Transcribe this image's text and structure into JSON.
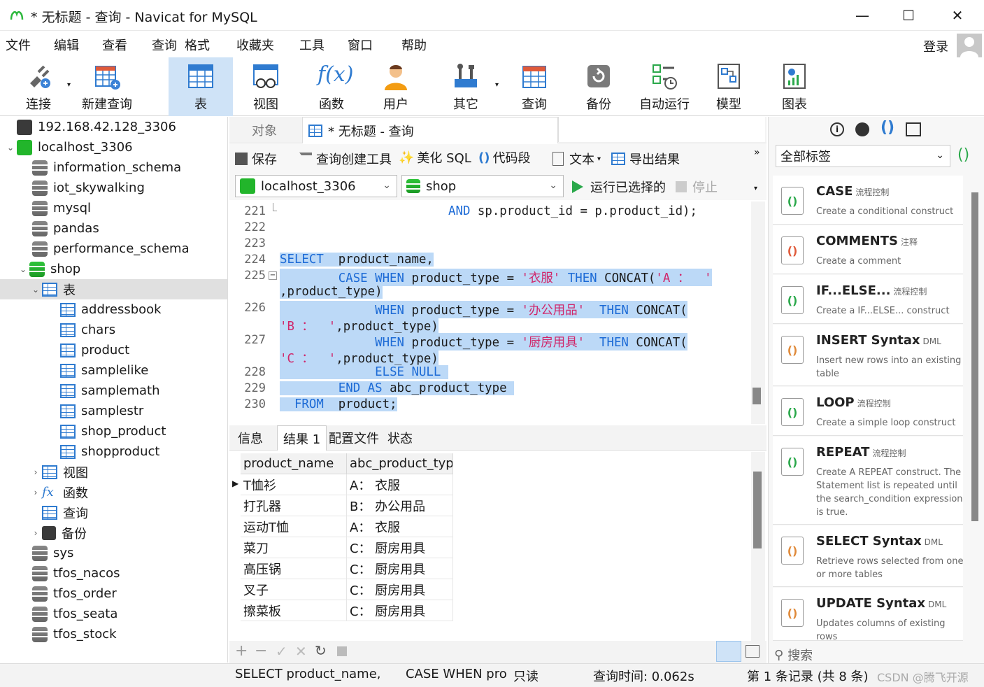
{
  "window": {
    "title": "* 无标题 - 查询 - Navicat for MySQL"
  },
  "menu": [
    "文件",
    "编辑",
    "查看",
    "查询",
    "格式",
    "收藏夹",
    "工具",
    "窗口",
    "帮助"
  ],
  "login": "登录",
  "toolbar": {
    "connect": "连接",
    "new_query": "新建查询",
    "table": "表",
    "view": "视图",
    "function": "函数",
    "user": "用户",
    "other": "其它",
    "query": "查询",
    "backup": "备份",
    "auto_run": "自动运行",
    "model": "模型",
    "chart": "图表"
  },
  "tree": {
    "conn1": "192.168.42.128_3306",
    "conn2": "localhost_3306",
    "dbs": [
      "information_schema",
      "iot_skywalking",
      "mysql",
      "pandas",
      "performance_schema",
      "shop"
    ],
    "tables_group": "表",
    "tables": [
      "addressbook",
      "chars",
      "product",
      "samplelike",
      "samplemath",
      "samplestr",
      "shop_product",
      "shopproduct"
    ],
    "views": "视图",
    "functions": "函数",
    "queries": "查询",
    "backups": "备份",
    "dbs_after": [
      "sys",
      "tfos_nacos",
      "tfos_order",
      "tfos_seata",
      "tfos_stock"
    ]
  },
  "tabs": {
    "objects": "对象",
    "query_tab": "* 无标题 - 查询"
  },
  "sql_tools": {
    "save": "保存",
    "builder": "查询创建工具",
    "beautify": "美化 SQL",
    "snippet": "代码段",
    "text": "文本",
    "export": "导出结果"
  },
  "selectors": {
    "connection": "localhost_3306",
    "database": "shop",
    "run_selected": "运行已选择的",
    "stop": "停止"
  },
  "editor": {
    "lines": [
      {
        "n": "221",
        "text": "AND sp.product_id = p.product_id);"
      },
      {
        "n": "222",
        "text": ""
      },
      {
        "n": "223",
        "text": ""
      },
      {
        "n": "224",
        "text": "SELECT  product_name,"
      },
      {
        "n": "225",
        "text": "CASE WHEN product_type = '衣服' THEN CONCAT('A ： '"
      },
      {
        "n": "",
        "text": ",product_type)"
      },
      {
        "n": "226",
        "text": "WHEN product_type = '办公用品'  THEN CONCAT("
      },
      {
        "n": "",
        "text": "'B ：  ',product_type)"
      },
      {
        "n": "227",
        "text": "WHEN product_type = '厨房用具'  THEN CONCAT("
      },
      {
        "n": "",
        "text": "'C ：  ',product_type)"
      },
      {
        "n": "228",
        "text": "ELSE NULL"
      },
      {
        "n": "229",
        "text": "END AS abc_product_type"
      },
      {
        "n": "230",
        "text": "FROM  product;"
      }
    ]
  },
  "result_tabs": [
    "信息",
    "结果 1",
    "配置文件",
    "状态"
  ],
  "grid": {
    "columns": [
      "product_name",
      "abc_product_type"
    ],
    "rows": [
      [
        "T恤衫",
        "A： 衣服"
      ],
      [
        "打孔器",
        "B： 办公用品"
      ],
      [
        "运动T恤",
        "A： 衣服"
      ],
      [
        "菜刀",
        "C： 厨房用具"
      ],
      [
        "高压锅",
        "C： 厨房用具"
      ],
      [
        "叉子",
        "C： 厨房用具"
      ],
      [
        "擦菜板",
        "C： 厨房用具"
      ]
    ]
  },
  "status": {
    "sql": "SELECT  product_name,",
    "sql2": "CASE WHEN pro",
    "readonly": "只读",
    "time": "查询时间: 0.062s",
    "record": "第 1 条记录 (共 8 条)",
    "watermark": "CSDN @腾飞开源"
  },
  "right_panel": {
    "tag_select": "全部标签",
    "search": "搜索",
    "snippets": [
      {
        "name": "CASE",
        "tag": "流程控制",
        "desc": "Create a conditional construct"
      },
      {
        "name": "COMMENTS",
        "tag": "注释",
        "desc": "Create a comment"
      },
      {
        "name": "IF...ELSE...",
        "tag": "流程控制",
        "desc": "Create a IF...ELSE... construct"
      },
      {
        "name": "INSERT Syntax",
        "tag": "DML",
        "desc": "Insert new rows into an existing table"
      },
      {
        "name": "LOOP",
        "tag": "流程控制",
        "desc": "Create a simple loop construct"
      },
      {
        "name": "REPEAT",
        "tag": "流程控制",
        "desc": "Create A REPEAT construct. The Statement list is repeated until the search_condition expression is true."
      },
      {
        "name": "SELECT Syntax",
        "tag": "DML",
        "desc": "Retrieve rows selected from one or more tables"
      },
      {
        "name": "UPDATE Syntax",
        "tag": "DML",
        "desc": "Updates columns of existing rows"
      }
    ]
  }
}
